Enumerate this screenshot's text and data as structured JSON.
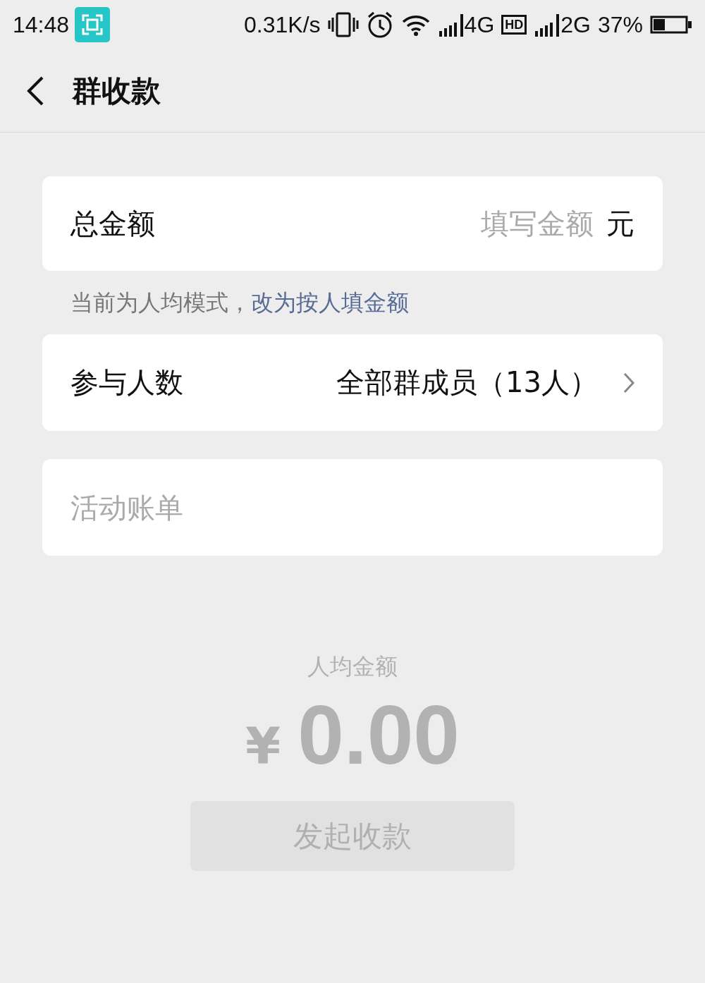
{
  "status_bar": {
    "time": "14:48",
    "speed": "0.31K/s",
    "network_1": "4G",
    "hd": "HD",
    "network_2": "2G",
    "battery": "37%"
  },
  "header": {
    "title": "群收款"
  },
  "total": {
    "label": "总金额",
    "placeholder": "填写金额",
    "unit": "元"
  },
  "mode_note": {
    "text": "当前为人均模式，",
    "link": "改为按人填金额"
  },
  "participants": {
    "label": "参与人数",
    "value": "全部群成员（13人）"
  },
  "bill": {
    "placeholder": "活动账单"
  },
  "per_person": {
    "label": "人均金额",
    "currency": "¥",
    "amount": "0.00"
  },
  "submit": {
    "label": "发起收款",
    "disabled": true
  }
}
